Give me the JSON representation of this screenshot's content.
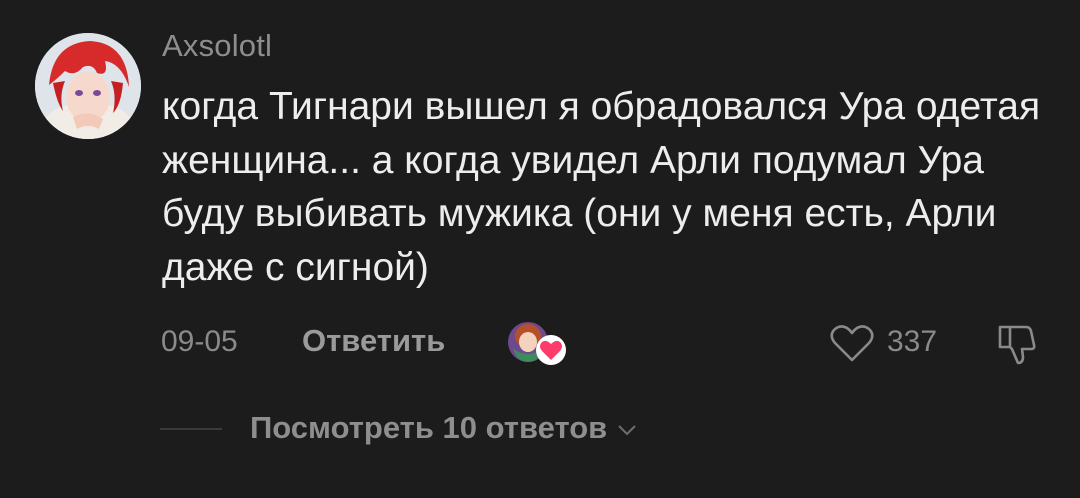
{
  "comment": {
    "username": "Axsolotl",
    "text": "когда Тигнари вышел я обрадовался Ура одетая женщина... а когда увидел Арли подумал Ура буду выбивать мужика (они у меня есть, Арли даже с сигной)",
    "date": "09-05",
    "reply_label": "Ответить",
    "like_count": "337",
    "view_replies_label": "Посмотреть 10 ответов"
  },
  "icons": {
    "like": "heart-outline-icon",
    "dislike": "thumbs-down-icon",
    "creator_like": "creator-liked-badge-icon",
    "expand": "chevron-down-icon"
  },
  "colors": {
    "background": "#1c1c1c",
    "text_primary": "#ededed",
    "text_secondary": "#8e8e8e",
    "heart_badge": "#ff3b6b"
  }
}
